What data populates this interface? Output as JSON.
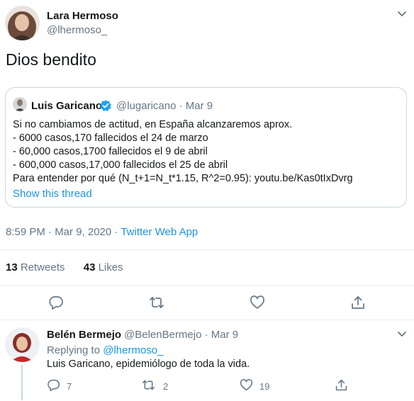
{
  "tweet": {
    "author_name": "Lara Hermoso",
    "author_handle": "@lhermoso_",
    "text": "Dios bendito",
    "timestamp": "8:59 PM · Mar 9, 2020 · ",
    "app": "Twitter Web App",
    "retweet_count": "13",
    "retweet_label": " Retweets",
    "like_count": "43",
    "like_label": " Likes"
  },
  "quoted": {
    "author_name": "Luis Garicano",
    "author_handle": "@lugaricano · Mar 9",
    "lines": [
      "Si no cambiamos de actitud, en España alcanzaremos aprox.",
      "- 6000 casos,170 fallecidos el 24 de marzo",
      "- 60,000 casos,1700 fallecidos el 9 de abril",
      "- 600,000 casos,17,000 fallecidos el 25 de abril",
      "Para entender por qué (N_t+1=N_t*1.15, R^2=0.95): youtu.be/Kas0tIxDvrg"
    ],
    "show_thread": "Show this thread"
  },
  "reply": {
    "author_name": "Belén Bermejo",
    "author_handle": "@BelenBermejo · Mar 9",
    "replying_prefix": "Replying to ",
    "replying_handle": "@lhermoso_",
    "text": "Luis Garicano, epidemiólogo de toda la vida.",
    "reply_count": "7",
    "retweet_count": "2",
    "like_count": "19"
  },
  "colors": {
    "link": "#1b95e0",
    "muted": "#657786",
    "text": "#14171a",
    "border": "#e6ecf0",
    "verified": "#1da1f2"
  }
}
